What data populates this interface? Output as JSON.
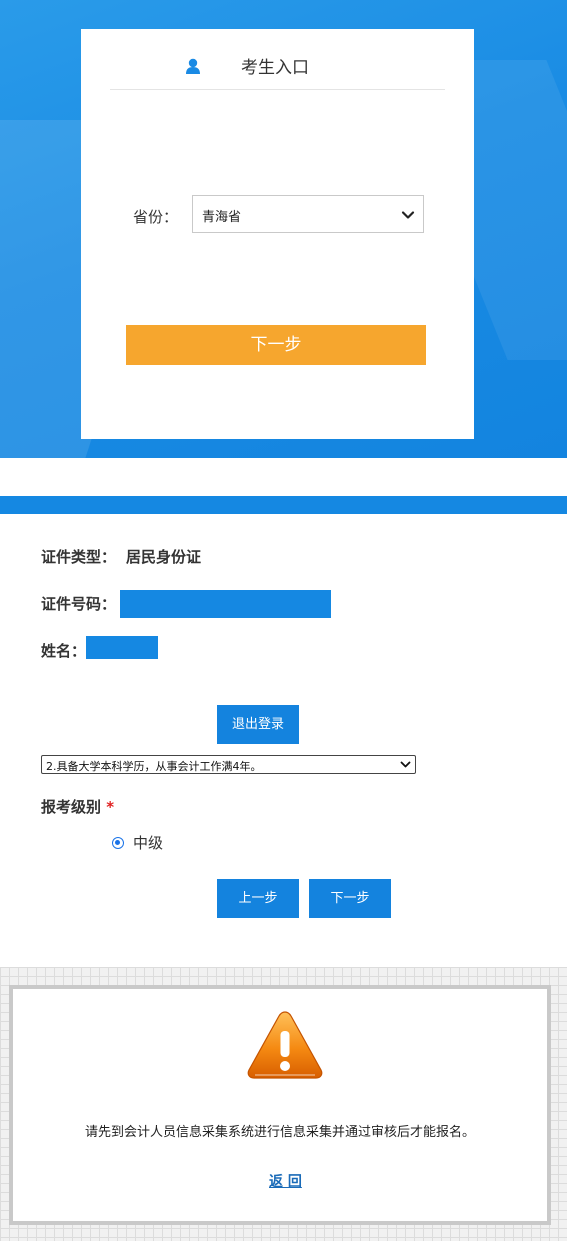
{
  "login": {
    "title": "考生入口",
    "province_label": "省份：",
    "province_value": "青海省",
    "next_label": "下一步"
  },
  "identity": {
    "id_type_label": "证件类型：",
    "id_type_value": "居民身份证",
    "id_number_label": "证件号码：",
    "name_label": "姓名：",
    "logout_label": "退出登录",
    "condition_value": "2.具备大学本科学历，从事会计工作满4年。",
    "level_label": "报考级别",
    "required_mark": "*",
    "level_option": "中级",
    "prev_label": "上一步",
    "next_label": "下一步"
  },
  "notice": {
    "message": "请先到会计人员信息采集系统进行信息采集并通过审核后才能报名。",
    "back_label": "返 回"
  },
  "icons": {
    "user": "user-icon",
    "chevron": "chevron-down-icon",
    "warning": "warning-icon"
  },
  "colors": {
    "brand_blue": "#1588e2",
    "orange_button": "#f6a62e",
    "required_red": "#e02020",
    "link_blue": "#1a6bb8"
  }
}
